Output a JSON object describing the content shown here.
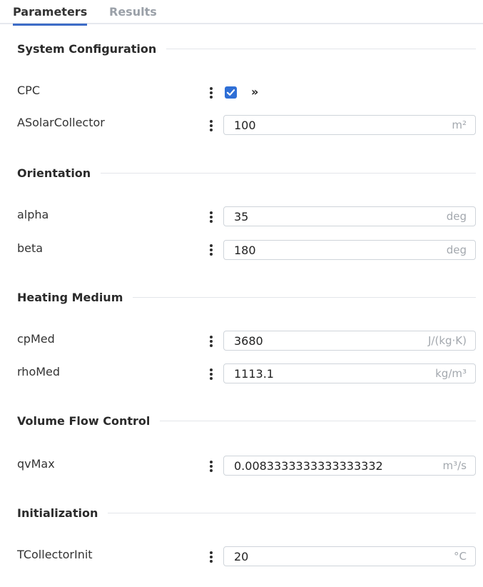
{
  "tabs": [
    {
      "label": "Parameters",
      "active": true
    },
    {
      "label": "Results",
      "active": false
    }
  ],
  "sections": {
    "system": "System Configuration",
    "orientation": "Orientation",
    "heating": "Heating Medium",
    "volume": "Volume Flow Control",
    "init": "Initialization"
  },
  "params": {
    "cpc": {
      "label": "CPC",
      "checked": true,
      "expand_glyph": "»"
    },
    "asolar": {
      "label": "ASolarCollector",
      "value": "100",
      "unit": "m²"
    },
    "alpha": {
      "label": "alpha",
      "value": "35",
      "unit": "deg"
    },
    "beta": {
      "label": "beta",
      "value": "180",
      "unit": "deg"
    },
    "cpmed": {
      "label": "cpMed",
      "value": "3680",
      "unit": "J/(kg·K)"
    },
    "rhomed": {
      "label": "rhoMed",
      "value": "1113.1",
      "unit": "kg/m³"
    },
    "qvmax": {
      "label": "qvMax",
      "value": "0.0083333333333333332",
      "unit": "m³/s"
    },
    "tcollector": {
      "label": "TCollectorInit",
      "value": "20",
      "unit": "°C"
    }
  },
  "colors": {
    "accent": "#3d6cc7",
    "checkbox": "#2f6fd6",
    "unit_text": "#a3a8ae",
    "inactive_tab": "#9aa0a8"
  },
  "icons": {
    "menu": "kebab-menu-icon",
    "check": "checkmark-icon",
    "expand": "double-chevron-right-icon"
  }
}
